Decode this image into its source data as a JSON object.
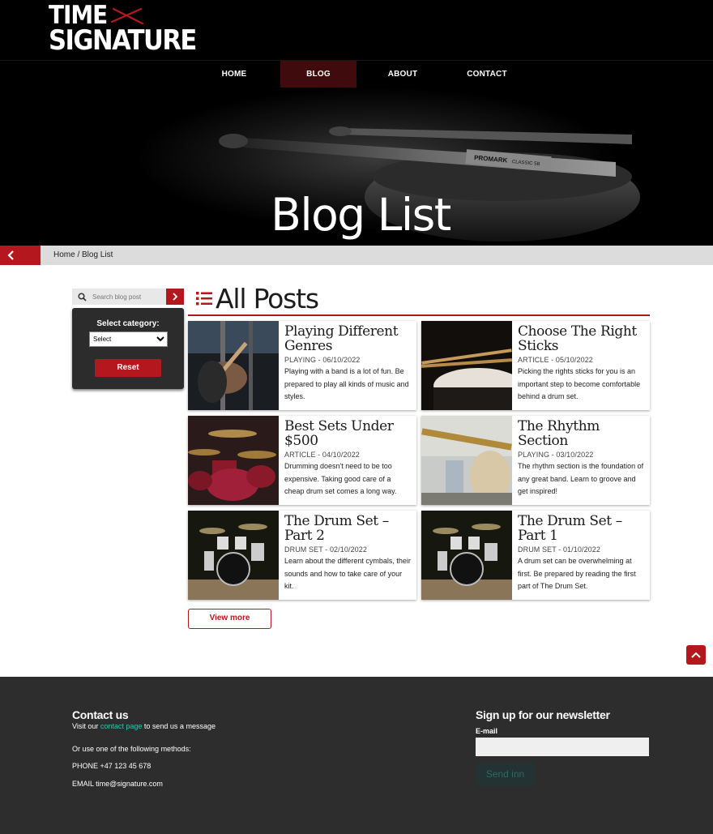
{
  "header": {
    "logo_line1": "TIME",
    "logo_line2": "SIGNATURE"
  },
  "nav": {
    "items": [
      {
        "label": "HOME",
        "active": false
      },
      {
        "label": "BLOG",
        "active": true
      },
      {
        "label": "ABOUT",
        "active": false
      },
      {
        "label": "CONTACT",
        "active": false
      }
    ]
  },
  "hero": {
    "title": "Blog List",
    "stick_brand": "PROMARK",
    "stick_model": "CLASSIC 5B"
  },
  "breadcrumb": {
    "text": "Home / Blog List"
  },
  "sidebar": {
    "search_placeholder": "Search blog post",
    "category_label": "Select category:",
    "category_selected": "Select",
    "reset_label": "Reset"
  },
  "main": {
    "heading": "All Posts",
    "posts": [
      {
        "title": "Playing Different Genres",
        "category": "PLAYING",
        "date": "06/10/2022",
        "description": "Playing with a band is a lot of fun. Be prepared to play all kinds of music and styles."
      },
      {
        "title": "Choose The Right Sticks",
        "category": "ARTICLE",
        "date": "05/10/2022",
        "description": "Picking the rights sticks for you is an important step to become comfortable behind a drum set."
      },
      {
        "title": "Best Sets Under $500",
        "category": "ARTICLE",
        "date": "04/10/2022",
        "description": "Drumming doesn't need to be too expensive. Taking good care of a cheap drum set comes a long way."
      },
      {
        "title": "The Rhythm Section",
        "category": "PLAYING",
        "date": "03/10/2022",
        "description": "The rhythm section is the foundation of any great band. Learn to groove and get inspired!"
      },
      {
        "title": "The Drum Set – Part 2",
        "category": "DRUM SET",
        "date": "02/10/2022",
        "description": "Learn about the different cymbals, their sounds and how to take care of your kit."
      },
      {
        "title": "The Drum Set – Part 1",
        "category": "DRUM SET",
        "date": "01/10/2022",
        "description": "A drum set can be overwhelming at first. Be prepared by reading the first part of The Drum Set."
      }
    ],
    "view_more_label": "View more"
  },
  "footer": {
    "contact_title": "Contact us",
    "visit_prefix": "Visit our ",
    "contact_link": "contact page",
    "visit_suffix": " to send us a message",
    "methods_text": "Or use one of the following methods:",
    "phone_text": "PHONE +47 123 45 678",
    "email_text": "EMAIL time@signature.com",
    "newsletter_title": "Sign up for our newsletter",
    "email_label": "E-mail",
    "send_label": "Send inn"
  },
  "colors": {
    "accent": "#b4181e",
    "nav_active": "#3f0b0d",
    "footer_bg": "#2d2d2d",
    "link": "#2ec4b6"
  },
  "icons": [
    "search-icon",
    "chevron-right-icon",
    "chevron-left-icon",
    "list-icon",
    "chevron-up-icon"
  ]
}
